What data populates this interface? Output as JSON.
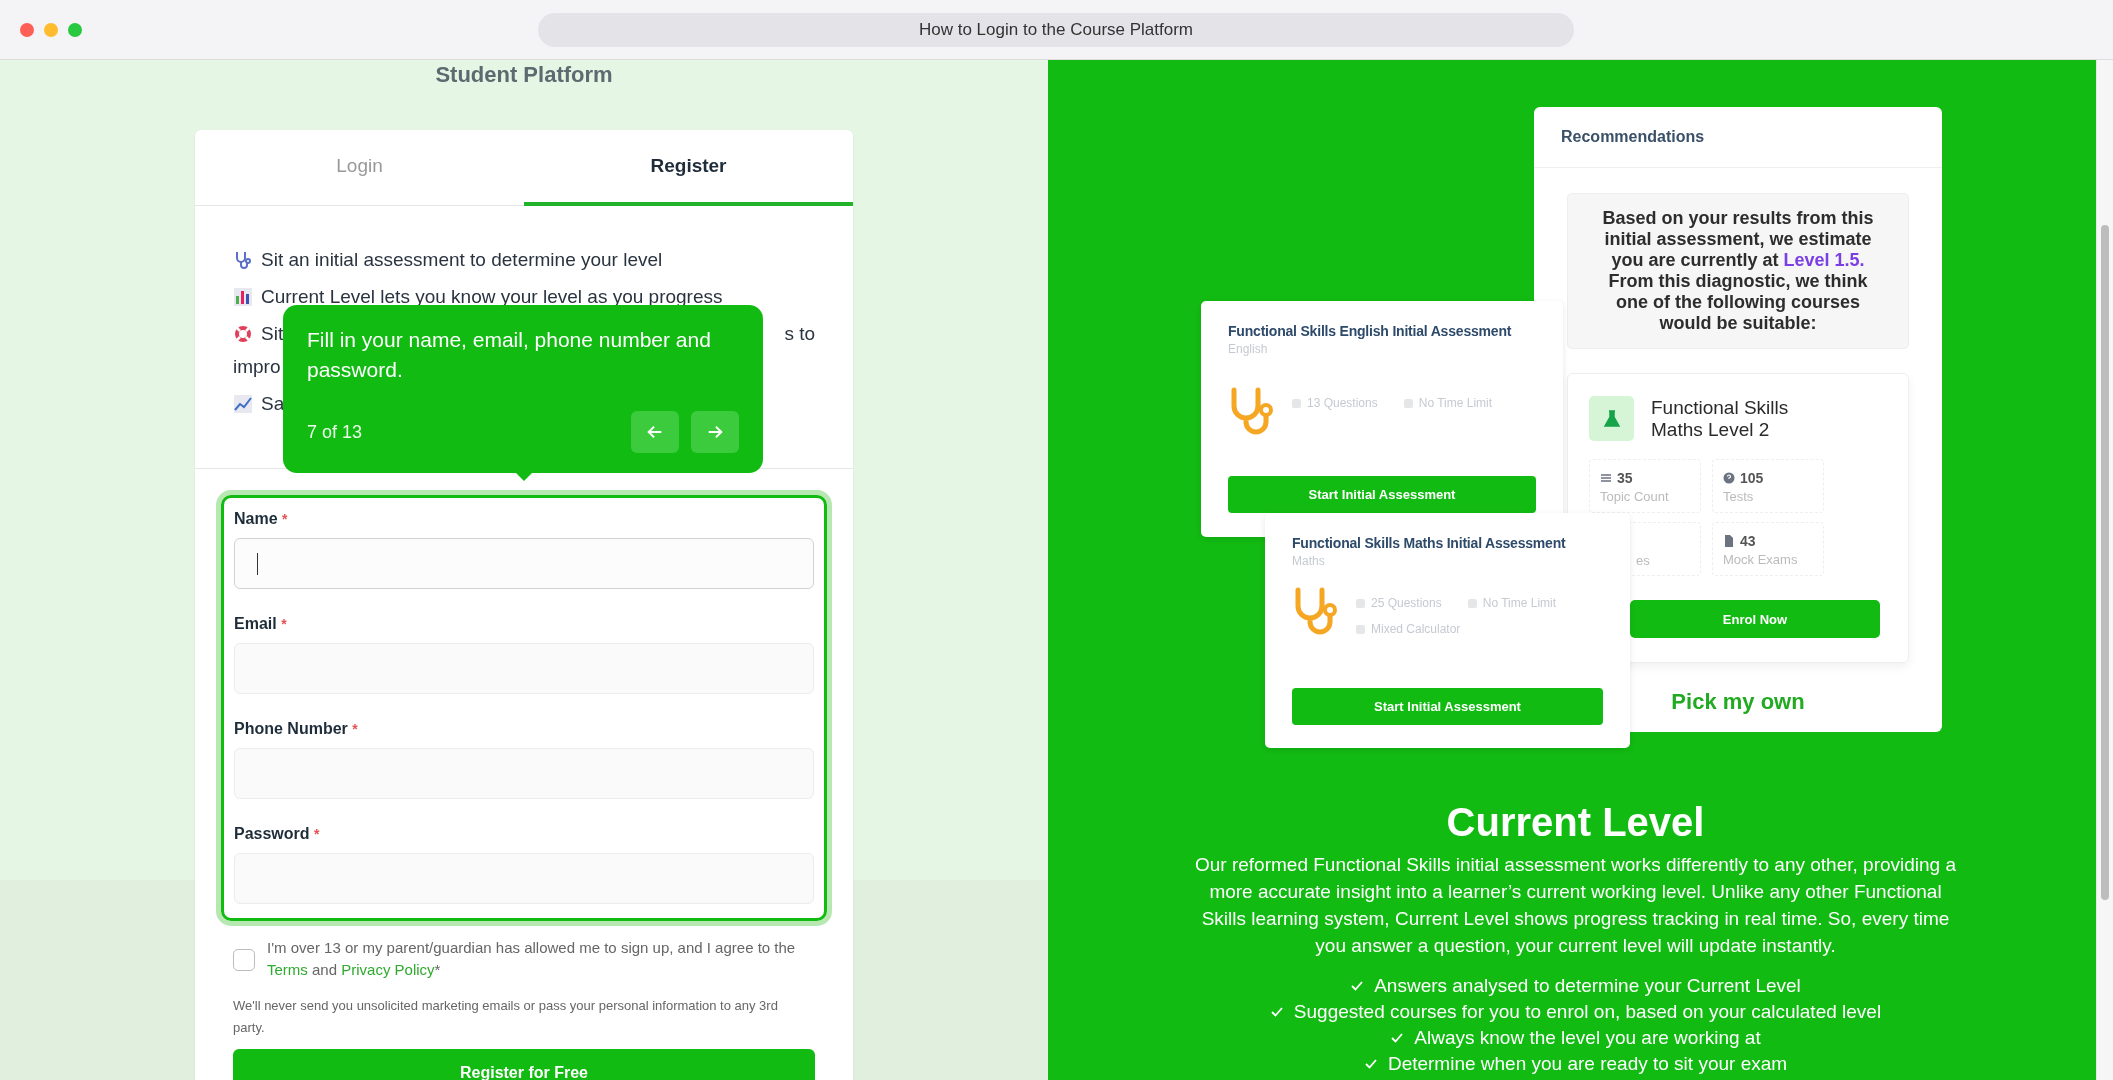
{
  "window": {
    "title": "How to Login to the Course Platform"
  },
  "left": {
    "heading": "Student Platform",
    "tabs": [
      {
        "label": "Login",
        "selected": false
      },
      {
        "label": "Register",
        "selected": true
      }
    ],
    "features": [
      {
        "text": "Sit an initial assessment to determine your level"
      },
      {
        "text": "Current Level lets you know your level as you progress"
      },
      {
        "text": "Sit",
        "text_end": "s to",
        "text_line2": "impro"
      },
      {
        "text": "Sa"
      }
    ],
    "fields": [
      {
        "label": "Name",
        "mark": "*",
        "focused": true
      },
      {
        "label": "Email",
        "mark": "*",
        "focused": false
      },
      {
        "label": "Phone Number",
        "mark": "*",
        "focused": false
      },
      {
        "label": "Password",
        "mark": "*",
        "focused": false
      }
    ],
    "consent": {
      "checked": false,
      "text": "I'm over 13 or my parent/guardian has allowed me to sign up, and I agree to the",
      "terms": "Terms",
      "joiner": "and",
      "privacy": "Privacy Policy",
      "suffix": "*"
    },
    "note": "We'll never send you unsolicited marketing emails or pass your personal information to any 3rd party.",
    "submit": "Register for Free"
  },
  "tooltip": {
    "text": "Fill in your name, email, phone number and password.",
    "step": "7 of 13"
  },
  "right": {
    "recommendations": {
      "title": "Recommendations",
      "summary_before": "Based on your results from this initial assessment, we estimate you are currently at",
      "level": "Level 1.5.",
      "summary_after": "From this diagnostic, we think one of the following courses would be suitable:",
      "course": {
        "title": "Functional Skills Maths Level 2",
        "stats": [
          {
            "value": "35",
            "label": "Topic Count"
          },
          {
            "value": "105",
            "label": "Tests"
          },
          {
            "label": "es"
          },
          {
            "value": "43",
            "label": "Mock Exams"
          }
        ],
        "button": "Enrol Now"
      },
      "pick": "Pick my own"
    },
    "assessments": [
      {
        "title": "Functional Skills English Initial Assessment",
        "subject": "English",
        "meta": [
          "13 Questions",
          "No Time Limit"
        ],
        "button": "Start Initial Assessment"
      },
      {
        "title": "Functional Skills Maths Initial Assessment",
        "subject": "Maths",
        "meta": [
          "25 Questions",
          "No Time Limit",
          "Mixed Calculator"
        ],
        "button": "Start Initial Assessment"
      }
    ],
    "current": {
      "heading": "Current Level",
      "body": "Our reformed Functional Skills initial assessment works differently to any other, providing a more accurate insight into a learner’s current working level. Unlike any other Functional Skills learning system, Current Level shows progress tracking in real time. So, every time you answer a question, your current level will update instantly.",
      "points": [
        "Answers analysed to determine your Current Level",
        "Suggested courses for you to enrol on, based on your calculated level",
        "Always know the level you are working at",
        "Determine when you are ready to sit your exam"
      ]
    }
  }
}
